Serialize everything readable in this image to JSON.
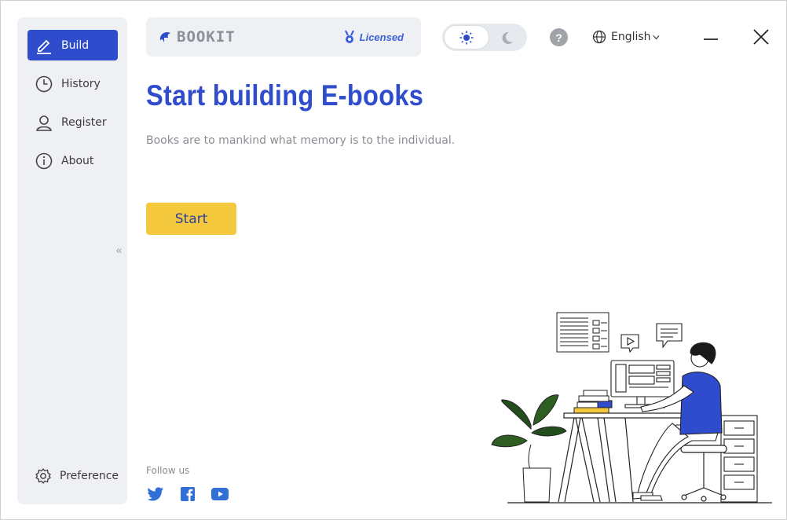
{
  "sidebar": {
    "items": [
      {
        "label": "Build",
        "icon": "pencil-icon",
        "active": true
      },
      {
        "label": "History",
        "icon": "clock-icon",
        "active": false
      },
      {
        "label": "Register",
        "icon": "user-icon",
        "active": false
      },
      {
        "label": "About",
        "icon": "info-icon",
        "active": false
      }
    ],
    "preference": {
      "label": "Preference",
      "icon": "gear-icon"
    },
    "collapse_glyph": "«"
  },
  "brand": {
    "name": "BOOKIT",
    "license_label": "Licensed"
  },
  "header": {
    "theme": {
      "current": "light",
      "icons": [
        "sun-icon",
        "moon-icon"
      ]
    },
    "help_label": "?",
    "language": "English"
  },
  "main": {
    "headline": "Start building E-books",
    "subtitle": "Books are to mankind what memory is to the individual.",
    "start_label": "Start"
  },
  "footer": {
    "follow_label": "Follow us",
    "social": [
      "twitter-icon",
      "facebook-icon",
      "youtube-icon"
    ]
  },
  "colors": {
    "accent": "#2f4ccc",
    "button": "#f5c93d",
    "sidebar_bg": "#eef0f4"
  }
}
